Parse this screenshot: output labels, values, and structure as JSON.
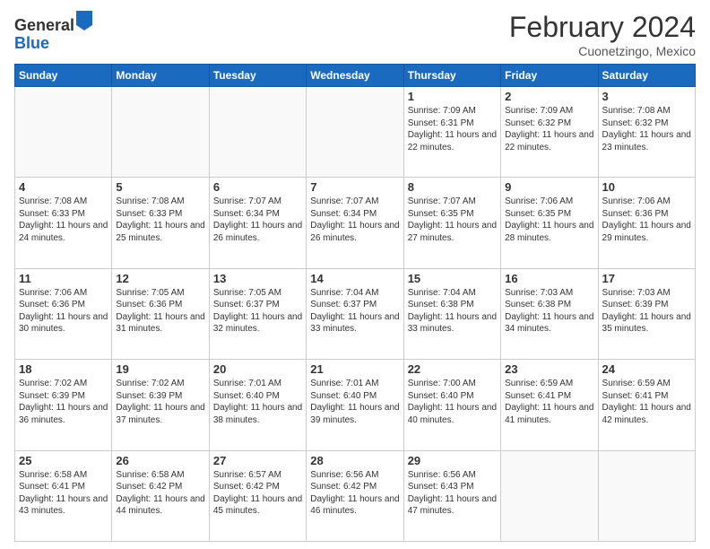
{
  "header": {
    "logo_general": "General",
    "logo_blue": "Blue",
    "month_title": "February 2024",
    "location": "Cuonetzingo, Mexico"
  },
  "weekdays": [
    "Sunday",
    "Monday",
    "Tuesday",
    "Wednesday",
    "Thursday",
    "Friday",
    "Saturday"
  ],
  "weeks": [
    [
      {
        "day": "",
        "info": ""
      },
      {
        "day": "",
        "info": ""
      },
      {
        "day": "",
        "info": ""
      },
      {
        "day": "",
        "info": ""
      },
      {
        "day": "1",
        "info": "Sunrise: 7:09 AM\nSunset: 6:31 PM\nDaylight: 11 hours and 22 minutes."
      },
      {
        "day": "2",
        "info": "Sunrise: 7:09 AM\nSunset: 6:32 PM\nDaylight: 11 hours and 22 minutes."
      },
      {
        "day": "3",
        "info": "Sunrise: 7:08 AM\nSunset: 6:32 PM\nDaylight: 11 hours and 23 minutes."
      }
    ],
    [
      {
        "day": "4",
        "info": "Sunrise: 7:08 AM\nSunset: 6:33 PM\nDaylight: 11 hours and 24 minutes."
      },
      {
        "day": "5",
        "info": "Sunrise: 7:08 AM\nSunset: 6:33 PM\nDaylight: 11 hours and 25 minutes."
      },
      {
        "day": "6",
        "info": "Sunrise: 7:07 AM\nSunset: 6:34 PM\nDaylight: 11 hours and 26 minutes."
      },
      {
        "day": "7",
        "info": "Sunrise: 7:07 AM\nSunset: 6:34 PM\nDaylight: 11 hours and 26 minutes."
      },
      {
        "day": "8",
        "info": "Sunrise: 7:07 AM\nSunset: 6:35 PM\nDaylight: 11 hours and 27 minutes."
      },
      {
        "day": "9",
        "info": "Sunrise: 7:06 AM\nSunset: 6:35 PM\nDaylight: 11 hours and 28 minutes."
      },
      {
        "day": "10",
        "info": "Sunrise: 7:06 AM\nSunset: 6:36 PM\nDaylight: 11 hours and 29 minutes."
      }
    ],
    [
      {
        "day": "11",
        "info": "Sunrise: 7:06 AM\nSunset: 6:36 PM\nDaylight: 11 hours and 30 minutes."
      },
      {
        "day": "12",
        "info": "Sunrise: 7:05 AM\nSunset: 6:36 PM\nDaylight: 11 hours and 31 minutes."
      },
      {
        "day": "13",
        "info": "Sunrise: 7:05 AM\nSunset: 6:37 PM\nDaylight: 11 hours and 32 minutes."
      },
      {
        "day": "14",
        "info": "Sunrise: 7:04 AM\nSunset: 6:37 PM\nDaylight: 11 hours and 33 minutes."
      },
      {
        "day": "15",
        "info": "Sunrise: 7:04 AM\nSunset: 6:38 PM\nDaylight: 11 hours and 33 minutes."
      },
      {
        "day": "16",
        "info": "Sunrise: 7:03 AM\nSunset: 6:38 PM\nDaylight: 11 hours and 34 minutes."
      },
      {
        "day": "17",
        "info": "Sunrise: 7:03 AM\nSunset: 6:39 PM\nDaylight: 11 hours and 35 minutes."
      }
    ],
    [
      {
        "day": "18",
        "info": "Sunrise: 7:02 AM\nSunset: 6:39 PM\nDaylight: 11 hours and 36 minutes."
      },
      {
        "day": "19",
        "info": "Sunrise: 7:02 AM\nSunset: 6:39 PM\nDaylight: 11 hours and 37 minutes."
      },
      {
        "day": "20",
        "info": "Sunrise: 7:01 AM\nSunset: 6:40 PM\nDaylight: 11 hours and 38 minutes."
      },
      {
        "day": "21",
        "info": "Sunrise: 7:01 AM\nSunset: 6:40 PM\nDaylight: 11 hours and 39 minutes."
      },
      {
        "day": "22",
        "info": "Sunrise: 7:00 AM\nSunset: 6:40 PM\nDaylight: 11 hours and 40 minutes."
      },
      {
        "day": "23",
        "info": "Sunrise: 6:59 AM\nSunset: 6:41 PM\nDaylight: 11 hours and 41 minutes."
      },
      {
        "day": "24",
        "info": "Sunrise: 6:59 AM\nSunset: 6:41 PM\nDaylight: 11 hours and 42 minutes."
      }
    ],
    [
      {
        "day": "25",
        "info": "Sunrise: 6:58 AM\nSunset: 6:41 PM\nDaylight: 11 hours and 43 minutes."
      },
      {
        "day": "26",
        "info": "Sunrise: 6:58 AM\nSunset: 6:42 PM\nDaylight: 11 hours and 44 minutes."
      },
      {
        "day": "27",
        "info": "Sunrise: 6:57 AM\nSunset: 6:42 PM\nDaylight: 11 hours and 45 minutes."
      },
      {
        "day": "28",
        "info": "Sunrise: 6:56 AM\nSunset: 6:42 PM\nDaylight: 11 hours and 46 minutes."
      },
      {
        "day": "29",
        "info": "Sunrise: 6:56 AM\nSunset: 6:43 PM\nDaylight: 11 hours and 47 minutes."
      },
      {
        "day": "",
        "info": ""
      },
      {
        "day": "",
        "info": ""
      }
    ]
  ]
}
